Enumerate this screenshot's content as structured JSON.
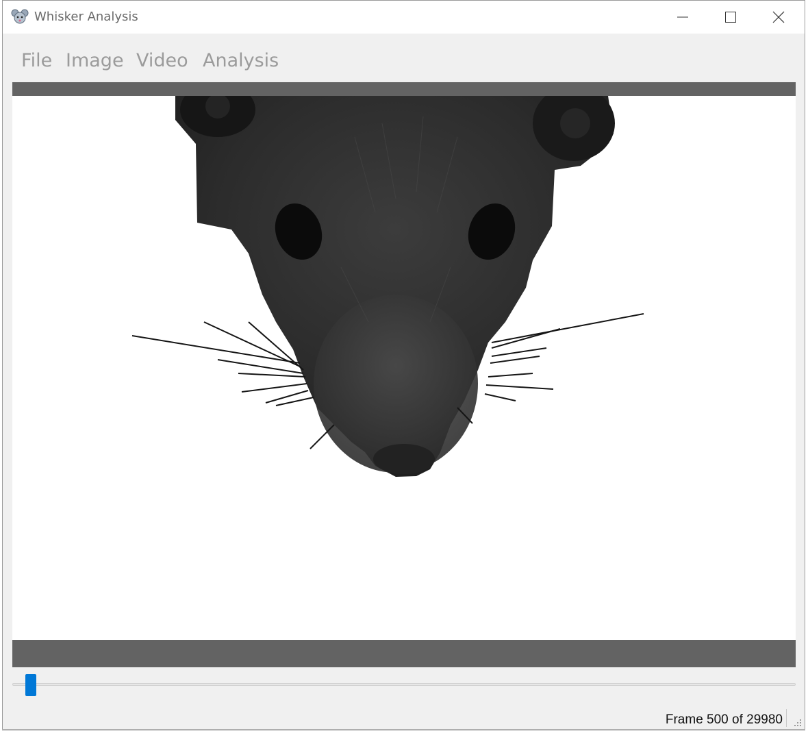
{
  "window": {
    "title": "Whisker Analysis",
    "app_icon": "mouse-icon",
    "controls": [
      "minimize-icon",
      "maximize-icon",
      "close-icon"
    ]
  },
  "menu": {
    "items": [
      {
        "label": "File"
      },
      {
        "label": "Image"
      },
      {
        "label": "Video"
      },
      {
        "label": "Analysis"
      }
    ]
  },
  "viewer": {
    "content": "mouse-head-image"
  },
  "playback": {
    "current_frame": 500,
    "total_frames": 29980
  },
  "status": {
    "frame_text": "Frame 500 of 29980"
  },
  "colors": {
    "accent": "#0078d7",
    "bar": "#636363",
    "menu_text": "#9b9b9b"
  }
}
